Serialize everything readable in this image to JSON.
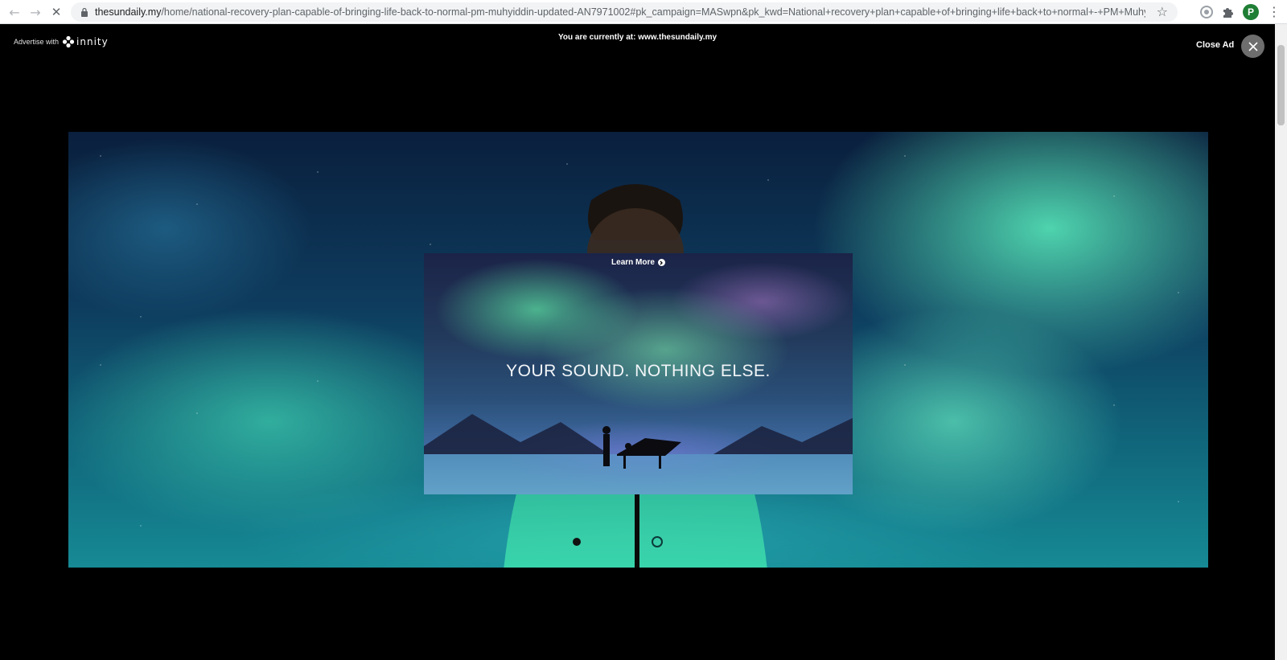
{
  "browser": {
    "url_host": "thesundaily.my",
    "url_path": "/home/national-recovery-plan-capable-of-bringing-life-back-to-normal-pm-muhyiddin-updated-AN7971002#pk_campaign=MASwpn&pk_kwd=National+recovery+plan+capable+of+bringing+life+back+to+normal+-+PM+Muhyiddin",
    "avatar_letter": "P",
    "icons": [
      "back-icon",
      "forward-icon",
      "stop-loading-icon",
      "lock-icon",
      "star-icon",
      "extension-icon",
      "puzzle-icon",
      "kebab-menu-icon"
    ]
  },
  "overlay": {
    "advertise_with": "Advertise with",
    "brand": "innity",
    "current_location": "You are currently at: www.thesundaily.my",
    "close_ad_label": "Close Ad"
  },
  "ad": {
    "learn_more": "Learn More",
    "headline": "YOUR SOUND. NOTHING ELSE.",
    "accent_aurora": "#3fe3b0",
    "accent_sky": "#0e3c5e"
  }
}
